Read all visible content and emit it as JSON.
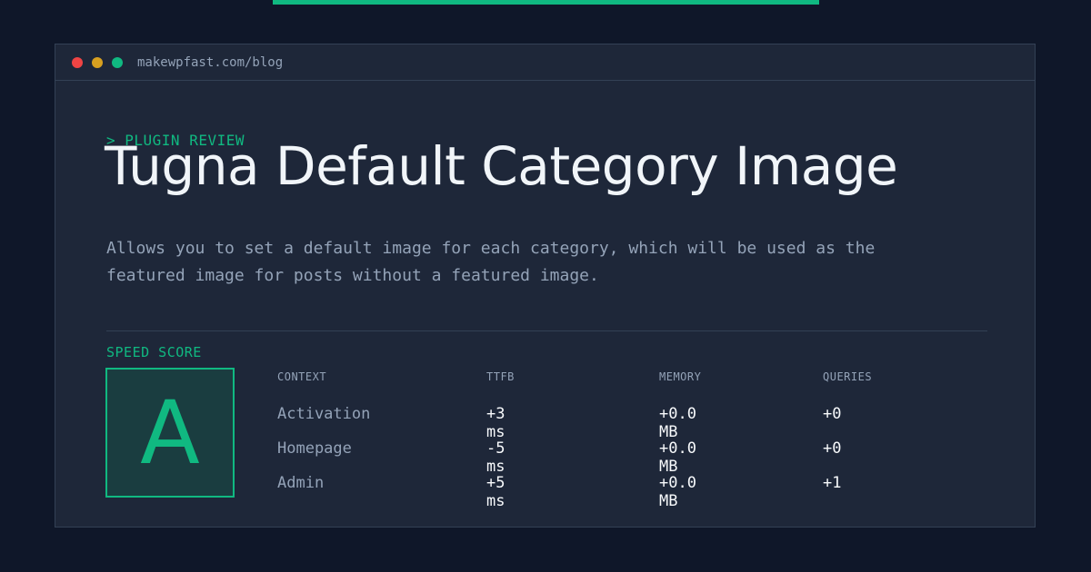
{
  "window": {
    "url": "makewpfast.com/blog"
  },
  "hero": {
    "kicker": "> PLUGIN REVIEW",
    "title": "Tugna Default Category Image",
    "description": "Allows you to set a default image for each category, which will be used as the featured image for posts without a featured image."
  },
  "speed_score": {
    "label": "SPEED SCORE",
    "grade": "A"
  },
  "metrics": {
    "headers": [
      "CONTEXT",
      "TTFB",
      "MEMORY",
      "QUERIES"
    ],
    "rows": [
      {
        "context": "Activation",
        "ttfb": "+3 ms",
        "memory": "+0.0 MB",
        "queries": "+0"
      },
      {
        "context": "Homepage",
        "ttfb": "-5 ms",
        "memory": "+0.0 MB",
        "queries": "+0"
      },
      {
        "context": "Admin",
        "ttfb": "+5 ms",
        "memory": "+0.0 MB",
        "queries": "+1"
      }
    ]
  },
  "colors": {
    "accent": "#10b981",
    "background": "#0f1729",
    "panel": "#1e2739"
  }
}
